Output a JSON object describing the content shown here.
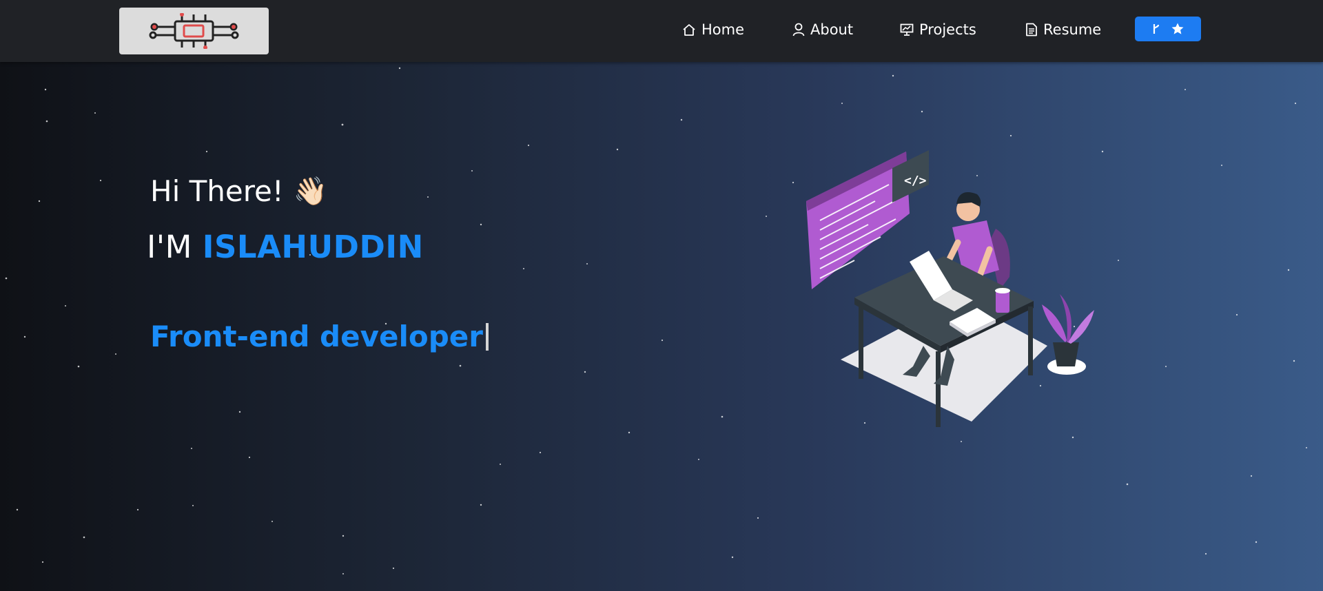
{
  "nav": {
    "logo_icon": "circuit-chip-icon",
    "items": [
      {
        "label": "Home",
        "icon": "home-icon"
      },
      {
        "label": "About",
        "icon": "user-icon"
      },
      {
        "label": "Projects",
        "icon": "presentation-chart-icon"
      },
      {
        "label": "Resume",
        "icon": "document-icon"
      }
    ],
    "fork_button": {
      "icons": [
        "git-fork-icon",
        "star-icon"
      ]
    }
  },
  "hero": {
    "greeting": "Hi There!",
    "greeting_emoji": "👋🏻",
    "intro_prefix": "I'M",
    "name": "ISLAHUDDIN",
    "role": "Front-end developer",
    "illustration": "developer-at-desk-illustration"
  },
  "colors": {
    "accent": "#1a8cf8",
    "navbar_bg": "#202226",
    "button_bg": "#1d7cf2",
    "illustration_purple": "#b05bd1"
  }
}
